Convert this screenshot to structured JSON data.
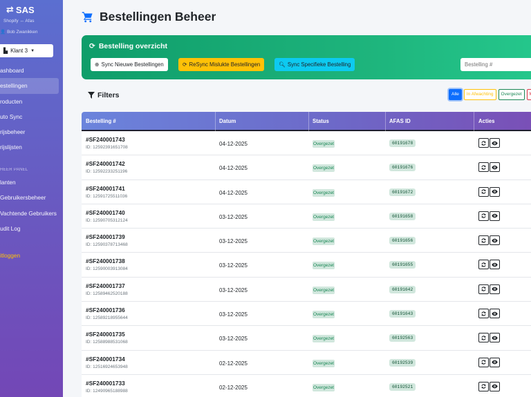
{
  "sidebar": {
    "brand": "SAS",
    "brand_sub": "Shopify ↔ Afas",
    "user": "Bob Zwanikken",
    "client": "Klant 3",
    "items": [
      {
        "label": "ashboard"
      },
      {
        "label": "estellingen",
        "active": true
      },
      {
        "label": "roducten"
      },
      {
        "label": "uto Sync"
      },
      {
        "label": "rijsbeheer"
      },
      {
        "label": "rijslijsten"
      }
    ],
    "section_label": "HEER PANEL",
    "admin_items": [
      {
        "label": "lanten"
      },
      {
        "label": "Gebruikersbeheer"
      },
      {
        "label": "Vachtende Gebruikers"
      },
      {
        "label": "udit Log"
      }
    ],
    "logout": "itloggen"
  },
  "header": {
    "title": "Bestellingen Beheer"
  },
  "overview": {
    "title": "Bestelling overzicht",
    "btn_sync_new": "Sync Nieuwe Bestellingen",
    "btn_resync_failed": "ReSync Mislukte Bestellingen",
    "btn_sync_specific": "Sync Specifieke Bestelling",
    "order_placeholder": "Bestelling #"
  },
  "filters": {
    "title": "Filters",
    "chips": [
      "Alle",
      "In Afwachting",
      "Overgezet",
      "M"
    ]
  },
  "table": {
    "columns": [
      "Bestelling #",
      "Datum",
      "Status",
      "AFAS ID",
      "Acties"
    ],
    "rows": [
      {
        "order": "#SF240001743",
        "id": "ID: 12592391651708",
        "date": "04-12-2025",
        "status": "Overgezet",
        "afas": "60191678"
      },
      {
        "order": "#SF240001742",
        "id": "ID: 12592233251196",
        "date": "04-12-2025",
        "status": "Overgezet",
        "afas": "60191676"
      },
      {
        "order": "#SF240001741",
        "id": "ID: 12591725511036",
        "date": "04-12-2025",
        "status": "Overgezet",
        "afas": "60191672"
      },
      {
        "order": "#SF240001740",
        "id": "ID: 12590705312124",
        "date": "03-12-2025",
        "status": "Overgezet",
        "afas": "60191658"
      },
      {
        "order": "#SF240001739",
        "id": "ID: 12590378713468",
        "date": "03-12-2025",
        "status": "Overgezet",
        "afas": "60191656"
      },
      {
        "order": "#SF240001738",
        "id": "ID: 12590003913084",
        "date": "03-12-2025",
        "status": "Overgezet",
        "afas": "60191655"
      },
      {
        "order": "#SF240001737",
        "id": "ID: 12589462520188",
        "date": "03-12-2025",
        "status": "Overgezet",
        "afas": "60191642"
      },
      {
        "order": "#SF240001736",
        "id": "ID: 12589218955644",
        "date": "03-12-2025",
        "status": "Overgezet",
        "afas": "60191643"
      },
      {
        "order": "#SF240001735",
        "id": "ID: 12588988531068",
        "date": "03-12-2025",
        "status": "Overgezet",
        "afas": "60192563"
      },
      {
        "order": "#SF240001734",
        "id": "ID: 12516924653948",
        "date": "02-12-2025",
        "status": "Overgezet",
        "afas": "60192539"
      },
      {
        "order": "#SF240001733",
        "id": "ID: 12490965188988",
        "date": "02-12-2025",
        "status": "Overgezet",
        "afas": "60192521"
      }
    ]
  },
  "colors": {
    "accent_blue": "#0d6efd",
    "success": "#198754",
    "warning": "#ffc107",
    "info": "#0dcaf0",
    "danger": "#dc3545"
  },
  "icons": {
    "brand": "swap-arrows-icon",
    "user": "user-icon",
    "client": "building-icon",
    "title": "shopping-cart-icon",
    "overview": "sync-icon",
    "filters": "funnel-icon",
    "search": "search-icon",
    "row_sync": "sync-icon",
    "row_view": "eye-icon"
  }
}
